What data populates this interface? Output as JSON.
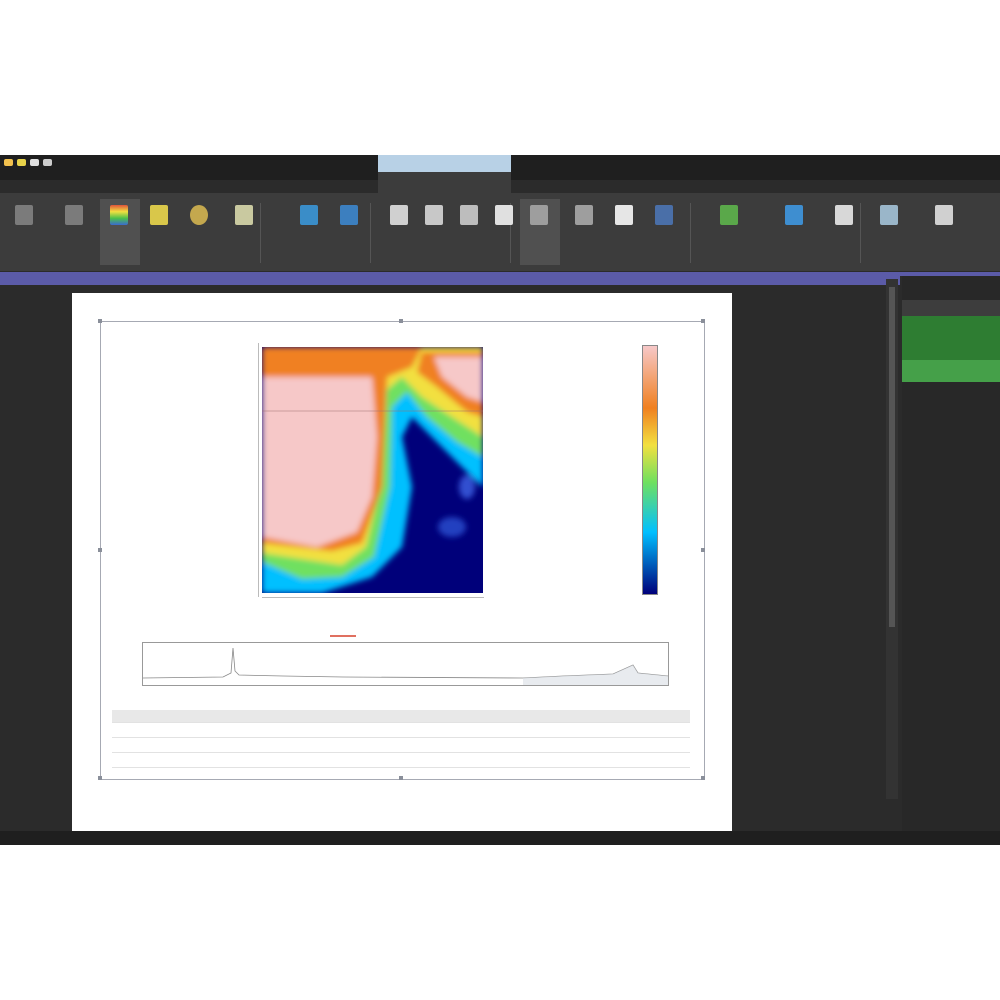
{
  "window": {
    "title": "",
    "quick_access": [
      {
        "icon": "open-folder-icon",
        "color": "#f2c14e"
      },
      {
        "icon": "save-icon",
        "color": "#e8d34a"
      },
      {
        "icon": "brush-icon",
        "color": "#e0e0e0"
      },
      {
        "icon": "arrow-icon",
        "color": "#cccccc"
      }
    ]
  },
  "menu_tabs": [
    "",
    "",
    "",
    "",
    "",
    "",
    ""
  ],
  "context_tab": {
    "label": ""
  },
  "ribbon": {
    "buttons": [
      {
        "name": "ribbon-btn-1",
        "icon": "doc-icon",
        "color": "#7b7b7b",
        "label": ""
      },
      {
        "name": "ribbon-btn-2",
        "icon": "doc-icon",
        "color": "#7b7b7b",
        "label": ""
      },
      {
        "name": "ribbon-btn-colormap",
        "icon": "colormap-icon",
        "color": "#e0533a",
        "label": "",
        "selected": true
      },
      {
        "name": "ribbon-btn-4",
        "icon": "image-icon",
        "color": "#d9c74a",
        "label": ""
      },
      {
        "name": "ribbon-btn-5",
        "icon": "sphere-icon",
        "color": "#c4a84e",
        "label": ""
      },
      {
        "name": "ribbon-btn-6",
        "icon": "list-icon",
        "color": "#c9c9a0",
        "label": ""
      },
      {
        "name": "ribbon-btn-7",
        "icon": "line-icon",
        "color": "#3a8dc8",
        "label": ""
      },
      {
        "name": "ribbon-btn-8",
        "icon": "cube-icon",
        "color": "#3c7fbf",
        "label": ""
      },
      {
        "name": "ribbon-btn-9",
        "icon": "cursor-icon",
        "color": "#d0d0d0",
        "label": ""
      },
      {
        "name": "ribbon-btn-10",
        "icon": "crop-icon",
        "color": "#c8c8c8",
        "label": ""
      },
      {
        "name": "ribbon-btn-11",
        "icon": "grid-icon",
        "color": "#bdbdbd",
        "label": ""
      },
      {
        "name": "ribbon-btn-12",
        "icon": "dots-icon",
        "color": "#e0e0e0",
        "label": ""
      },
      {
        "name": "ribbon-btn-13",
        "icon": "profile-icon",
        "color": "#9e9e9e",
        "label": "",
        "selected": true
      },
      {
        "name": "ribbon-btn-14",
        "icon": "profile-icon",
        "color": "#9e9e9e",
        "label": ""
      },
      {
        "name": "ribbon-btn-15",
        "icon": "square-icon",
        "color": "#e6e6e6",
        "label": ""
      },
      {
        "name": "ribbon-btn-16",
        "icon": "shape-icon",
        "color": "#4a6fa8",
        "label": ""
      },
      {
        "name": "ribbon-btn-17",
        "icon": "image-icon",
        "color": "#5aa84a",
        "label": ""
      },
      {
        "name": "ribbon-btn-18",
        "icon": "cup-icon",
        "color": "#3e8ed0",
        "label": ""
      },
      {
        "name": "ribbon-btn-19",
        "icon": "pin-icon",
        "color": "#d8d8d8",
        "label": ""
      },
      {
        "name": "ribbon-btn-20",
        "icon": "person-icon",
        "color": "#9ab6c9",
        "label": ""
      },
      {
        "name": "ribbon-btn-21",
        "icon": "expand-icon",
        "color": "#d0d0d0",
        "label": ""
      }
    ]
  },
  "report": {
    "map": {
      "y_ticks": [
        "",
        "",
        "",
        "",
        ""
      ],
      "x_ticks": [
        "",
        "",
        "",
        ""
      ],
      "colors": {
        "low": "#00007a",
        "mid": "#00c0ff",
        "high_mid": "#f08020",
        "high": "#f6c8c8"
      }
    },
    "colorbar": {
      "labels": [
        "",
        "",
        "",
        ""
      ]
    },
    "spectrum": {
      "legend": "",
      "y_ticks": [
        "",
        "",
        ""
      ],
      "x_ticks": [
        "",
        "",
        "",
        "",
        "",
        "",
        "",
        "",
        "",
        "",
        "",
        "",
        "",
        "",
        ""
      ]
    },
    "table": {
      "header": "",
      "rows": [
        {
          "k": "",
          "v": ""
        },
        {
          "k": "",
          "v": ""
        },
        {
          "k": "",
          "v": ""
        }
      ]
    }
  },
  "right_panel": {
    "title": ""
  },
  "status_bar": {
    "items": [
      "",
      "",
      ""
    ]
  }
}
